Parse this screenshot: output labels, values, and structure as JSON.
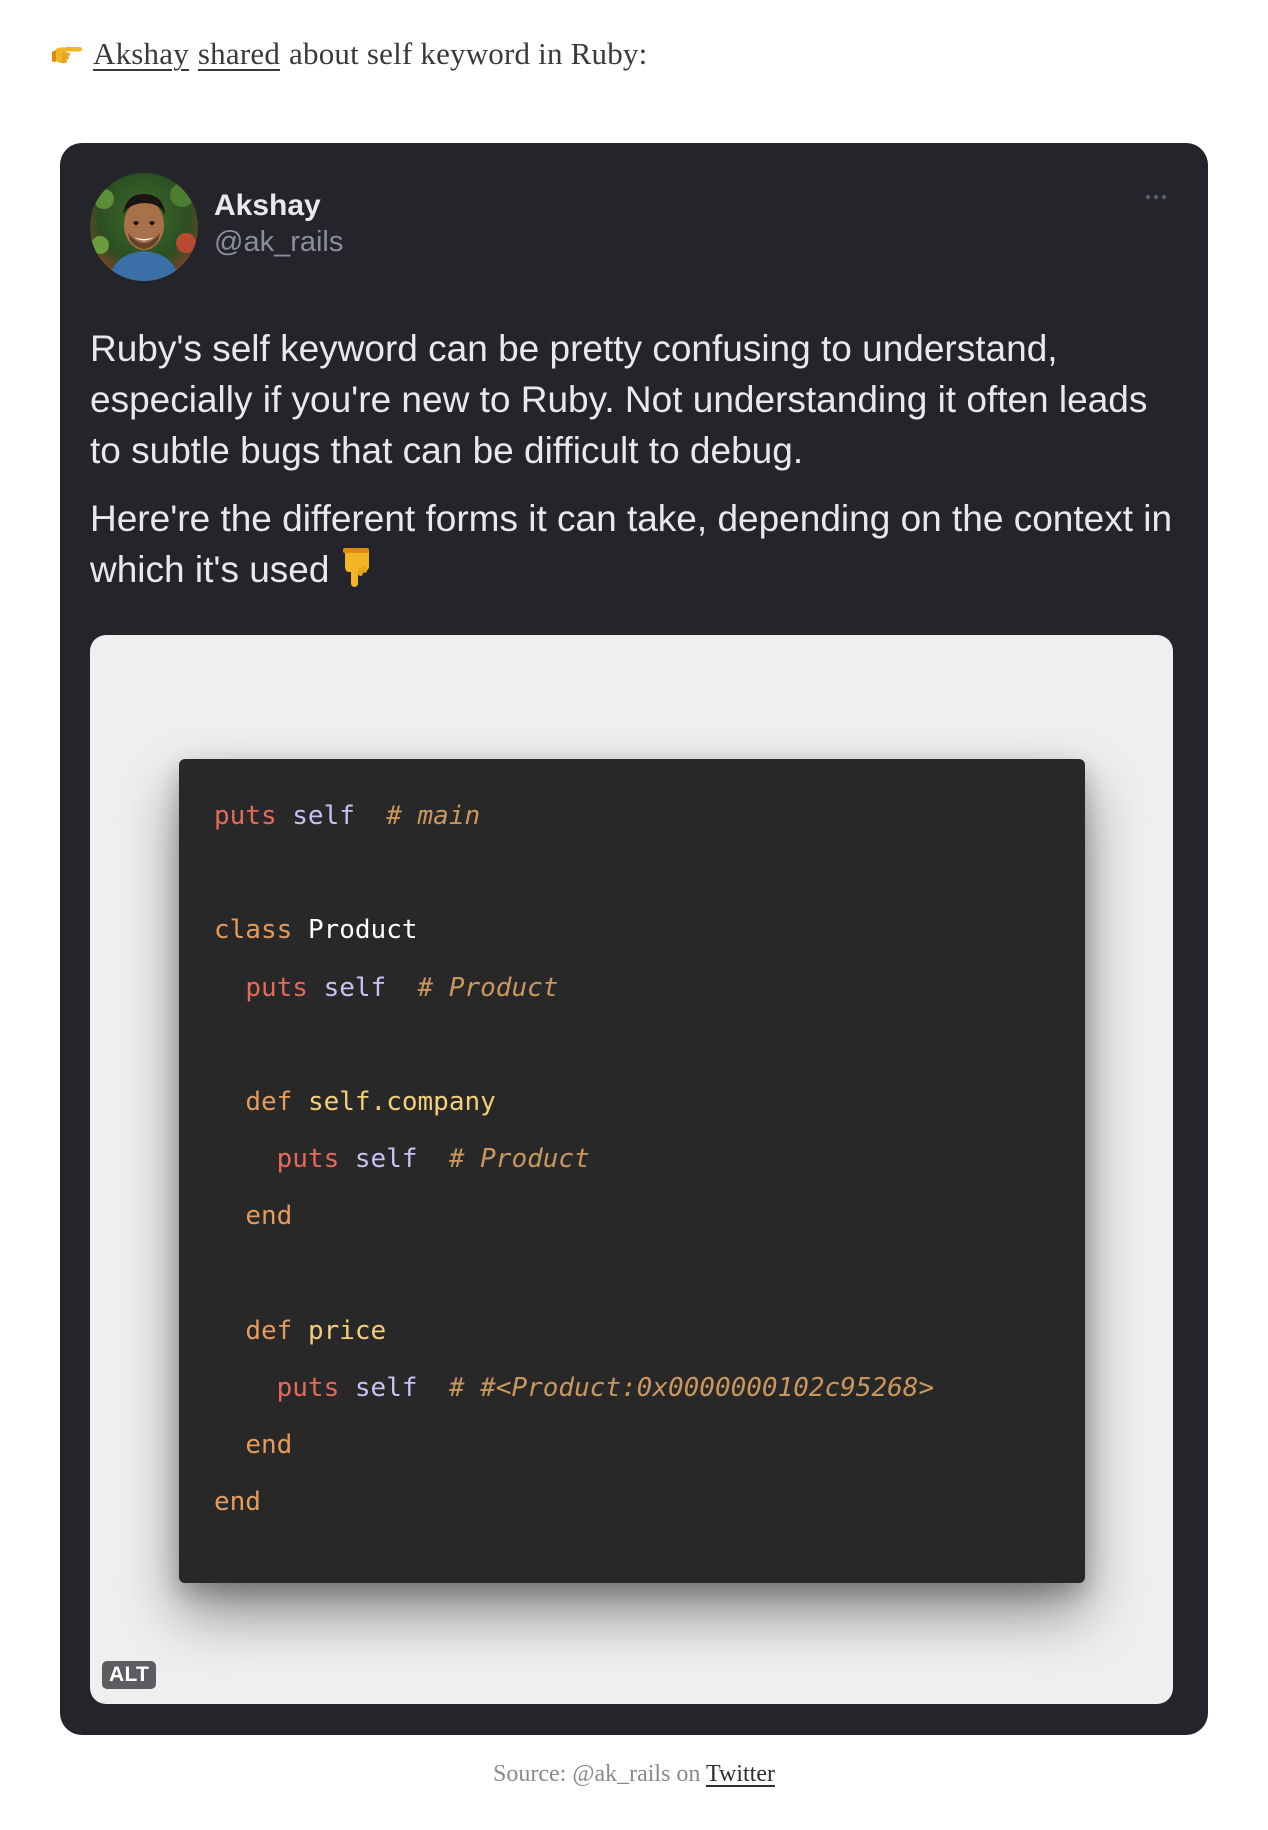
{
  "intro": {
    "icon": "pointing-right-hand-icon",
    "author_link": "Akshay",
    "shared_link": "shared",
    "rest": "about self keyword in Ruby:"
  },
  "tweet": {
    "author_name": "Akshay",
    "author_handle": "@ak_rails",
    "more_icon": "more-options-icon",
    "paragraph1": "Ruby's self keyword can be pretty confusing to understand, especially if you're new to Ruby. Not understanding it often leads to subtle bugs that can be difficult to debug.",
    "paragraph2": "Here're the different forms it can take, depending on the context in which it's used",
    "paragraph2_emoji": "pointing-down-hand-icon",
    "alt_badge": "ALT"
  },
  "code": {
    "lines": [
      [
        {
          "t": "puts",
          "k": "kw"
        },
        {
          "t": " "
        },
        {
          "t": "self",
          "k": "self"
        },
        {
          "t": "  "
        },
        {
          "t": "# main",
          "k": "cmt"
        }
      ],
      [],
      [
        {
          "t": "class",
          "k": "def"
        },
        {
          "t": " "
        },
        {
          "t": "Product",
          "k": "const"
        }
      ],
      [
        {
          "t": "  "
        },
        {
          "t": "puts",
          "k": "kw"
        },
        {
          "t": " "
        },
        {
          "t": "self",
          "k": "self"
        },
        {
          "t": "  "
        },
        {
          "t": "# Product",
          "k": "cmt"
        }
      ],
      [],
      [
        {
          "t": "  "
        },
        {
          "t": "def",
          "k": "def"
        },
        {
          "t": " "
        },
        {
          "t": "self.company",
          "k": "fn"
        }
      ],
      [
        {
          "t": "    "
        },
        {
          "t": "puts",
          "k": "kw"
        },
        {
          "t": " "
        },
        {
          "t": "self",
          "k": "self"
        },
        {
          "t": "  "
        },
        {
          "t": "# Product",
          "k": "cmt"
        }
      ],
      [
        {
          "t": "  "
        },
        {
          "t": "end",
          "k": "def"
        }
      ],
      [],
      [
        {
          "t": "  "
        },
        {
          "t": "def",
          "k": "def"
        },
        {
          "t": " "
        },
        {
          "t": "price",
          "k": "fn"
        }
      ],
      [
        {
          "t": "    "
        },
        {
          "t": "puts",
          "k": "kw"
        },
        {
          "t": " "
        },
        {
          "t": "self",
          "k": "self"
        },
        {
          "t": "  "
        },
        {
          "t": "# #<Product:0x0000000102c95268>",
          "k": "cmt"
        }
      ],
      [
        {
          "t": "  "
        },
        {
          "t": "end",
          "k": "def"
        }
      ],
      [
        {
          "t": "end",
          "k": "def"
        }
      ]
    ]
  },
  "caption": {
    "prefix": "Source: @ak_rails on",
    "link": "Twitter"
  },
  "colors": {
    "card_bg": "#23252b",
    "media_bg": "#efefef",
    "code_bg": "#282828",
    "keyword": "#e46a5c",
    "definition": "#e49b5b",
    "self": "#c9c1f2",
    "function": "#f4cf7a",
    "comment": "#c8975e"
  }
}
